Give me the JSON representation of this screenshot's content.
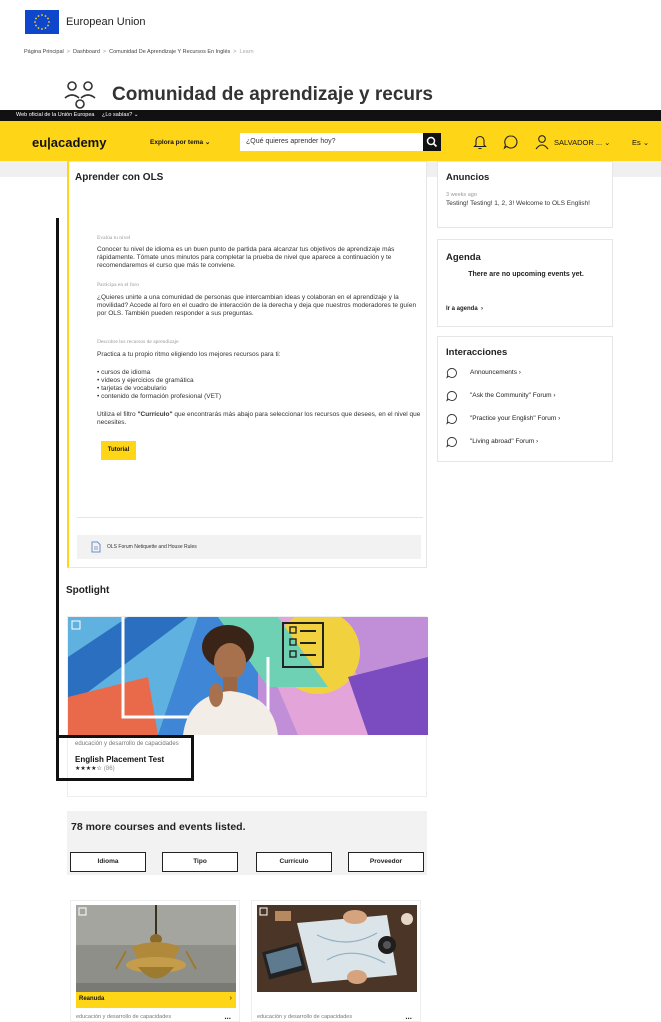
{
  "eu_header": {
    "name": "European Union"
  },
  "breadcrumb": {
    "items": [
      "Página Principal",
      "Dashboard",
      "Comunidad De Aprendizaje Y Recursos En Inglés",
      "Learn"
    ],
    "separator": ">"
  },
  "page": {
    "title": "Comunidad de aprendizaje y recurs"
  },
  "official_bar": {
    "text": "Web oficial de la Unión Europea",
    "toggle": "¿Lo sabías? ⌄"
  },
  "academy_bar": {
    "logo": "eu|academy",
    "explore": "Explora por tema ⌄",
    "search_placeholder": "¿Qué quieres aprender hoy?",
    "user": "SALVADOR ... ⌄",
    "language": "Es ⌄",
    "accent": "#ffd617"
  },
  "main_card": {
    "title": "Aprender con OLS",
    "section1_head": "Evalúa tu nivel",
    "section1_text": "Conocer tu nivel de idioma es un buen punto de partida para alcanzar tus objetivos de aprendizaje más rápidamente. Tómate unos minutos para completar la prueba de nivel que aparece a continuación y te recomendaremos el curso que más te conviene.",
    "section2_head": "Participa en el foro",
    "section2_text": "¿Quieres unirte a una comunidad de personas que intercambian ideas y colaboran en el aprendizaje y la movilidad? Accede al foro en el cuadro de interacción de la derecha y deja que nuestros moderadores te guíen por OLS. También pueden responder a sus preguntas.",
    "section3_head": "Descubre los recursos de aprendizaje",
    "section3_text": "Practica a tu propio ritmo eligiendo los mejores recursos para ti:",
    "bullets": [
      "cursos de idioma",
      "vídeos y ejercicios de gramática",
      "tarjetas de vocabulario",
      "contenido de formación profesional (VET)"
    ],
    "filter_pre": "Utiliza el filtro ",
    "filter_word": "\"Currículo\"",
    "filter_post": " que encontrarás más abajo para seleccionar los recursos que desees, en el nivel que necesites.",
    "tutorial_label": "Tutorial",
    "etiquette_label": "OLS Forum Netiquette and House Rules"
  },
  "announcements": {
    "title": "Anuncios",
    "time": "3 weeks ago",
    "text": "Testing! Testing! 1, 2, 3! Welcome to OLS English!"
  },
  "agenda": {
    "title": "Agenda",
    "empty": "There are no upcoming events yet.",
    "link": "Ir a agenda"
  },
  "interactions": {
    "title": "Interacciones",
    "items": [
      "Announcements",
      "\"Ask the Community\" Forum",
      "\"Practice your English\" Forum",
      "\"Living abroad\" Forum"
    ]
  },
  "spotlight": {
    "title": "Spotlight",
    "category": "educación y desarrollo de capacidades",
    "name": "English Placement Test",
    "stars": "★★★★☆",
    "rating_value": 4,
    "count": "(86)"
  },
  "more": {
    "title": "78 more courses and events listed.",
    "filters": [
      "Idioma",
      "Tipo",
      "Currículo",
      "Proveedor"
    ]
  },
  "courses": [
    {
      "status": "Reanuda",
      "category": "educación y desarrollo de capacidades",
      "menu": "..."
    },
    {
      "category": "educación y desarrollo de capacidades",
      "menu": "..."
    }
  ]
}
